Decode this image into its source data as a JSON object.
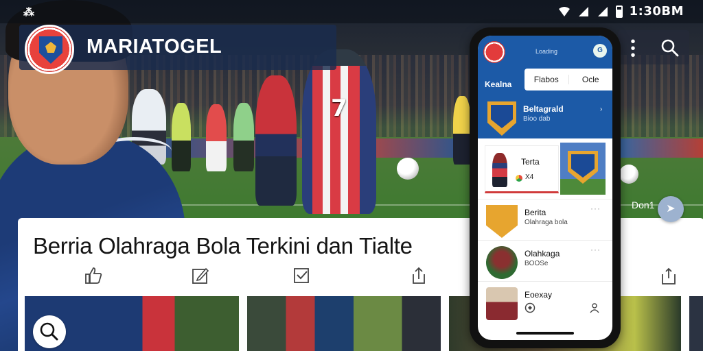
{
  "status_bar": {
    "left_icon": "app-indicator-icon",
    "time": "1:30BM",
    "left_glyph": "⁂"
  },
  "app_bar": {
    "brand": "MARIATOGEL",
    "icons": [
      "more-vert-icon",
      "search-icon"
    ]
  },
  "hero": {
    "jersey_number": "7"
  },
  "article": {
    "headline": "Berria Olahraga Bola Terkini dan Tialte",
    "actions": [
      "like-icon",
      "edit-icon",
      "checkbox-icon",
      "share-icon",
      "bookmark-share-icon"
    ]
  },
  "phone": {
    "top_label": "Loading",
    "tab_label": "Kealna",
    "tabs": [
      "Flabos",
      "Ocle"
    ],
    "top_badge": "G",
    "club": {
      "title": "Beltagrald",
      "subtitle": "Bioo dab"
    },
    "feature": {
      "title": "Terta",
      "meta": "X4"
    },
    "rows": [
      {
        "title": "Berita",
        "subtitle": "Olahraga bola",
        "more": "···"
      },
      {
        "title": "Olahkaga",
        "subtitle": "BOOSe",
        "more": "···"
      },
      {
        "title": "Eoexay",
        "subtitle": "",
        "more": ""
      }
    ]
  },
  "side_label": "Don1",
  "colors": {
    "brand_blue": "#1c5aa7",
    "accent_red": "#d03a3a",
    "appbar": "#1a2c4e"
  }
}
